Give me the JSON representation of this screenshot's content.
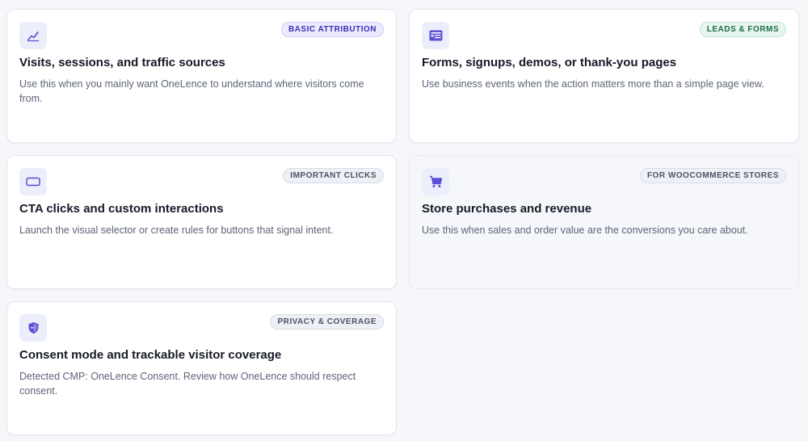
{
  "colors": {
    "accent": "#5b4fd6",
    "card_bg": "#ffffff",
    "page_bg": "#f6f7fb"
  },
  "cards": [
    {
      "icon": "chart-line-icon",
      "badge": "BASIC ATTRIBUTION",
      "title": "Visits, sessions, and traffic sources",
      "description": "Use this when you mainly want OneLence to understand where visitors come from."
    },
    {
      "icon": "form-icon",
      "badge": "LEADS & FORMS",
      "title": "Forms, signups, demos, or thank-you pages",
      "description": "Use business events when the action matters more than a simple page view."
    },
    {
      "icon": "button-icon",
      "badge": "IMPORTANT CLICKS",
      "title": "CTA clicks and custom interactions",
      "description": "Launch the visual selector or create rules for buttons that signal intent."
    },
    {
      "icon": "cart-icon",
      "badge": "FOR WOOCOMMERCE STORES",
      "title": "Store purchases and revenue",
      "description": "Use this when sales and order value are the conversions you care about."
    },
    {
      "icon": "shield-icon",
      "badge": "PRIVACY & COVERAGE",
      "title": "Consent mode and trackable visitor coverage",
      "description": "Detected CMP: OneLence Consent. Review how OneLence should respect consent."
    }
  ]
}
